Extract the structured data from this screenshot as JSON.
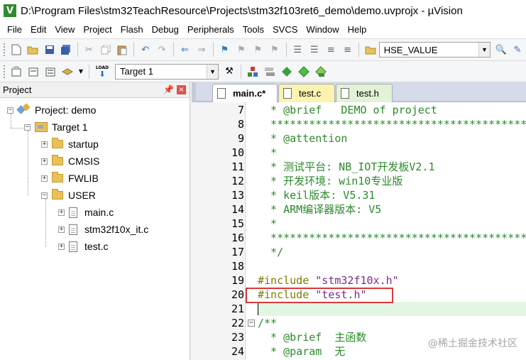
{
  "window": {
    "title": "D:\\Program Files\\stm32TeachResource\\Projects\\stm32f103ret6_demo\\demo.uvprojx - µVision",
    "app_icon_glyph": "V"
  },
  "menu": [
    "File",
    "Edit",
    "View",
    "Project",
    "Flash",
    "Debug",
    "Peripherals",
    "Tools",
    "SVCS",
    "Window",
    "Help"
  ],
  "toolbar1": {
    "find_combo_value": "HSE_VALUE"
  },
  "toolbar2": {
    "target_combo_value": "Target 1",
    "load_label": "LOAD"
  },
  "project_panel": {
    "header": "Project",
    "pin_glyph": "ᵖ",
    "close_glyph": "×",
    "root": "Project: demo",
    "target": "Target 1",
    "groups": [
      "startup",
      "CMSIS",
      "FWLIB",
      "USER"
    ],
    "user_files": [
      "main.c",
      "stm32f10x_it.c",
      "test.c"
    ]
  },
  "tabs": [
    {
      "label": "main.c*",
      "active": true,
      "color": "#ffffff"
    },
    {
      "label": "test.c",
      "active": false,
      "color": "#fdf3b0"
    },
    {
      "label": "test.h",
      "active": false,
      "color": "#e3f2d5"
    }
  ],
  "code_lines": [
    {
      "n": "7",
      "text": "  * @brief   DEMO of project"
    },
    {
      "n": "8",
      "text": "  ******************************************************************"
    },
    {
      "n": "9",
      "text": "  * @attention"
    },
    {
      "n": "10",
      "text": "  *"
    },
    {
      "n": "11",
      "text": "  * 测试平台: NB_IOT开发板V2.1"
    },
    {
      "n": "12",
      "text": "  * 开发环境: win10专业版"
    },
    {
      "n": "13",
      "text": "  * keil版本: V5.31"
    },
    {
      "n": "14",
      "text": "  * ARM编译器版本: V5"
    },
    {
      "n": "15",
      "text": "  *"
    },
    {
      "n": "16",
      "text": "  ******************************************************************"
    },
    {
      "n": "17",
      "text": "  */"
    },
    {
      "n": "18",
      "text": ""
    },
    {
      "n": "19",
      "pp": "#include ",
      "str": "\"stm32f10x.h\""
    },
    {
      "n": "20",
      "pp": "#include ",
      "str": "\"test.h\""
    },
    {
      "n": "21",
      "text": ""
    },
    {
      "n": "22",
      "text": "/**"
    },
    {
      "n": "23",
      "text": "  * @brief  主函数"
    },
    {
      "n": "24",
      "text": "  * @param  无"
    }
  ],
  "watermark": "@稀土掘金技术社区",
  "colors": {
    "comment": "#2b8a2b",
    "preprocessor": "#7b7b00",
    "string": "#7d2b8c",
    "highlight_border": "#d63a3a",
    "current_line": "#e3f5e3"
  }
}
